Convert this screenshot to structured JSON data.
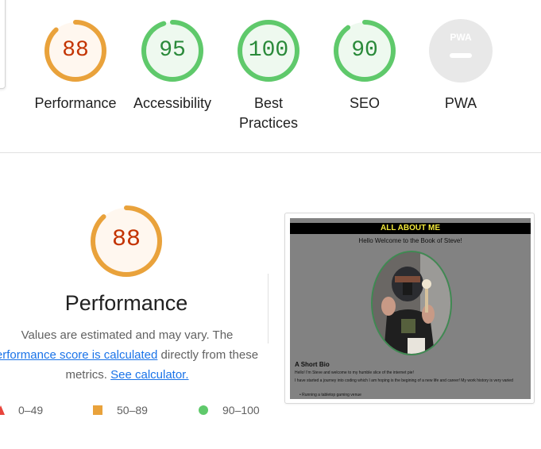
{
  "colors": {
    "average": "#e9a23b",
    "average_text": "#c33300",
    "average_fill": "#fff7ef",
    "pass": "#5fc96b",
    "pass_text": "#2a8a3a",
    "pass_fill": "#eef9ef",
    "na": "#e8e8e8",
    "link": "#1a73e8"
  },
  "summary": {
    "gauges": [
      {
        "id": "performance",
        "score": "88",
        "value": 88,
        "status": "average",
        "label": "Performance"
      },
      {
        "id": "accessibility",
        "score": "95",
        "value": 95,
        "status": "pass",
        "label": "Accessibility"
      },
      {
        "id": "best-practices",
        "score": "100",
        "value": 100,
        "status": "pass",
        "label": "Best Practices"
      },
      {
        "id": "seo",
        "score": "90",
        "value": 90,
        "status": "pass",
        "label": "SEO"
      },
      {
        "id": "pwa",
        "score": "",
        "status": "na",
        "label": "PWA",
        "badge": "PWA"
      }
    ]
  },
  "category": {
    "score": "88",
    "value": 88,
    "title": "Performance",
    "description_prefix": "Values are estimated and may vary. The",
    "link_score": "erformance score is calculated",
    "description_mid": " directly from these metrics. ",
    "link_calculator": "See calculator.",
    "description_suffix": ""
  },
  "legend": {
    "fail": "0–49",
    "average": "50–89",
    "pass": "90–100"
  },
  "screenshot": {
    "icon": "page-screenshot-thumbnail",
    "banner": "ALL ABOUT ME",
    "welcome": "Hello Welcome to the Book of Steve!",
    "bio_title": "A Short Bio",
    "bio_line1": "Hello! I'm Steve and welcome to my humble slice of the internet pie!",
    "bio_line2": "I have started a journey into coding which I am hoping is the begining of a new life and career! My work history is very varied",
    "bio_item": "• Running a tabletop gaming venue"
  }
}
